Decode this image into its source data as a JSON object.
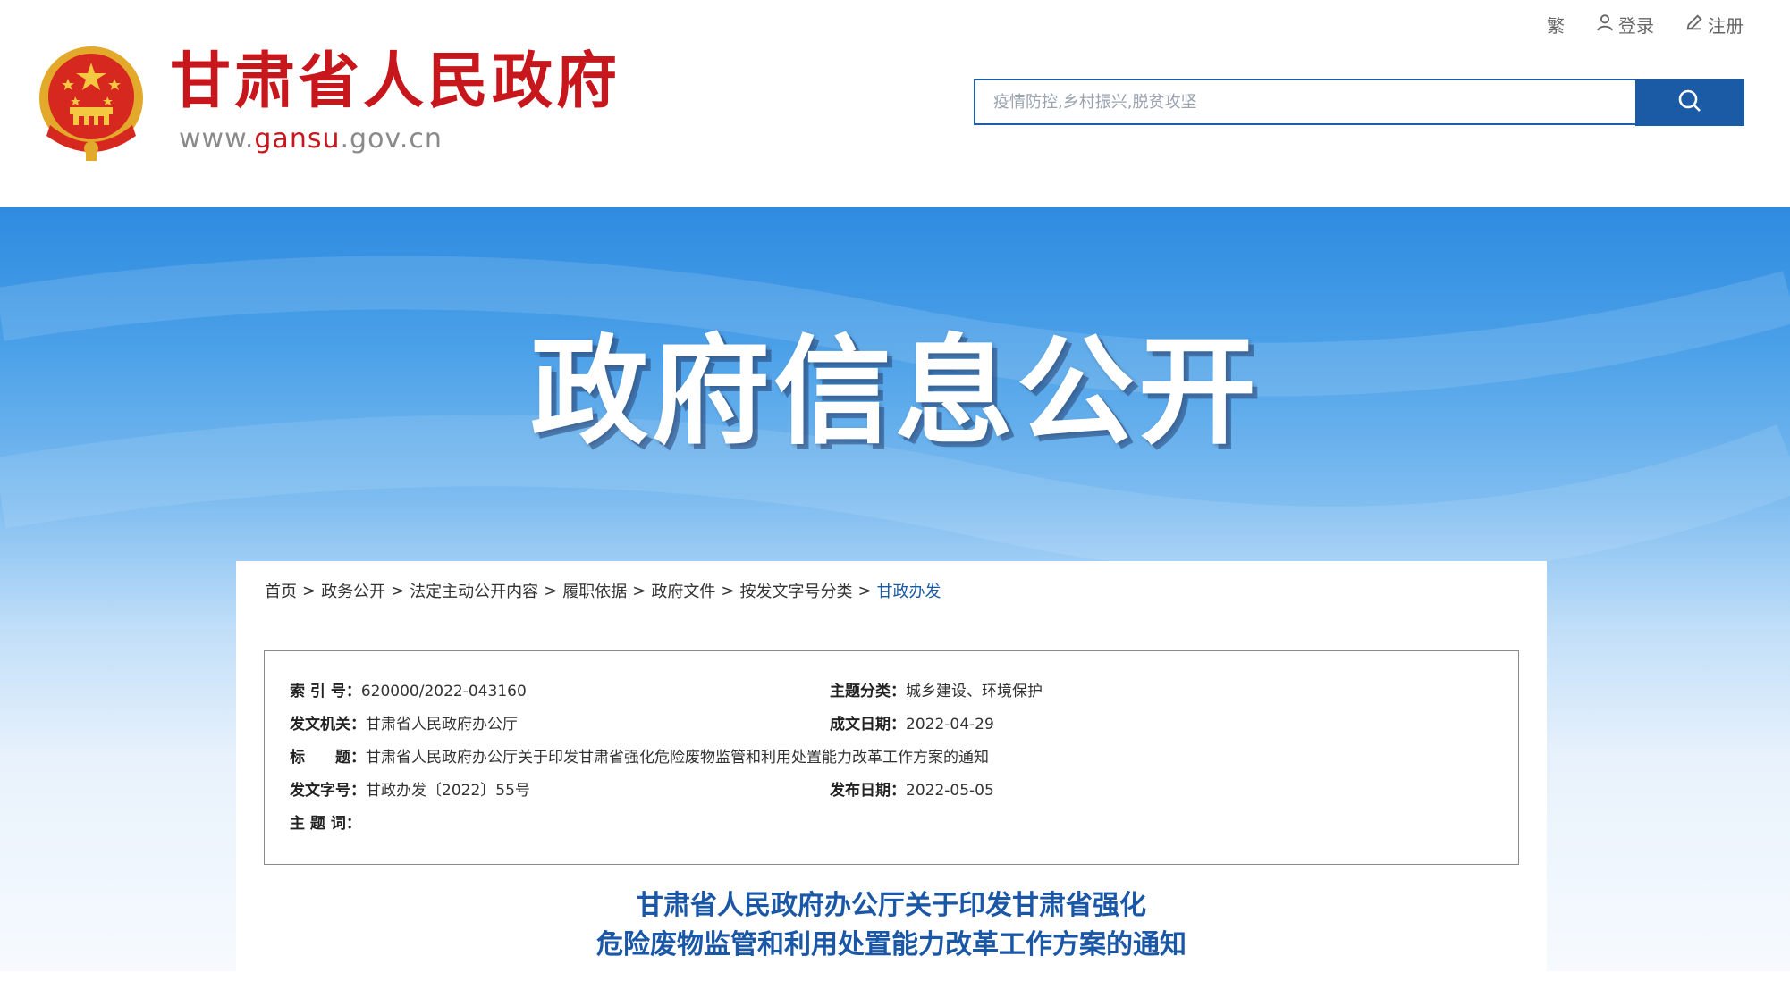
{
  "header": {
    "site_name": "甘肃省人民政府",
    "url_prefix": "www.",
    "url_brand": "gansu",
    "url_suffix": ".gov.cn",
    "top_links": {
      "traditional": "繁",
      "login": "登录",
      "register": "注册"
    },
    "search": {
      "placeholder": "疫情防控,乡村振兴,脱贫攻坚",
      "value": ""
    }
  },
  "banner": {
    "title": "政府信息公开"
  },
  "breadcrumb": [
    "首页",
    "政务公开",
    "法定主动公开内容",
    "履职依据",
    "政府文件",
    "按发文字号分类",
    "甘政办发"
  ],
  "breadcrumb_separator": ">",
  "meta": {
    "index_label": "索 引 号：",
    "index_value": "620000/2022-043160",
    "topic_label": "主题分类：",
    "topic_value": "城乡建设、环境保护",
    "issuer_label": "发文机关：",
    "issuer_value": "甘肃省人民政府办公厅",
    "created_label": "成文日期：",
    "created_value": "2022-04-29",
    "title_label": "标　　题：",
    "title_value": "甘肃省人民政府办公厅关于印发甘肃省强化危险废物监管和利用处置能力改革工作方案的通知",
    "docno_label": "发文字号：",
    "docno_value": "甘政办发〔2022〕55号",
    "published_label": "发布日期：",
    "published_value": "2022-05-05",
    "keywords_label": "主 题 词：",
    "keywords_value": ""
  },
  "document": {
    "title_line1": "甘肃省人民政府办公厅关于印发甘肃省强化",
    "title_line2": "危险废物监管和利用处置能力改革工作方案的通知"
  },
  "colors": {
    "brand_red": "#c8161d",
    "brand_blue": "#1b5aa5",
    "title_blue": "#1a57a6"
  },
  "icons": [
    "emblem-icon",
    "user-icon",
    "pencil-icon",
    "search-icon"
  ]
}
